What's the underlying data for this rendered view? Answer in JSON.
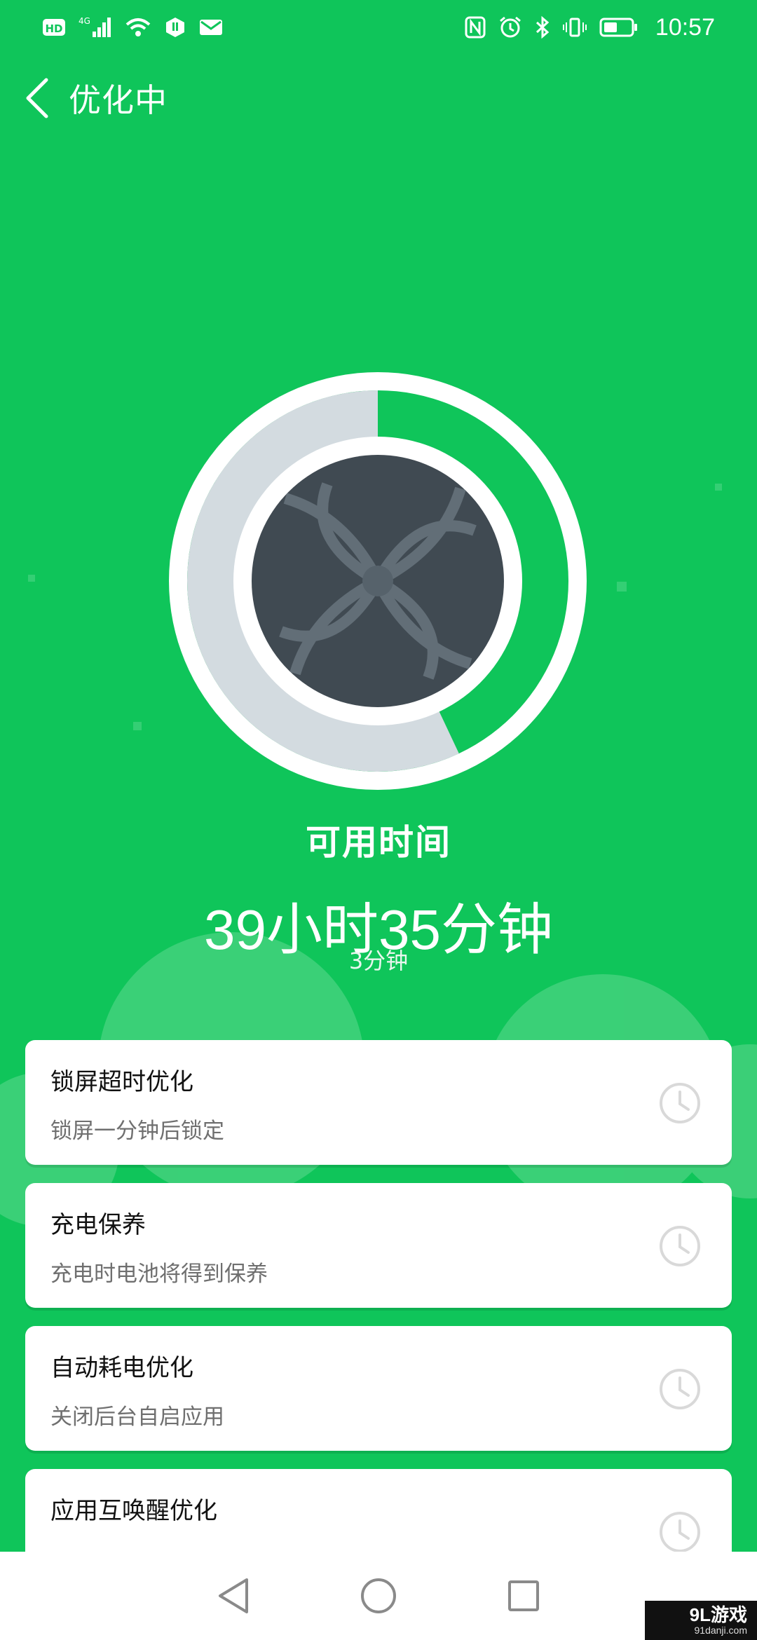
{
  "status_bar": {
    "hd_label": "HD",
    "network_label": "4G",
    "time": "10:57"
  },
  "header": {
    "title": "优化中"
  },
  "gauge": {
    "remaining_fraction": 0.57,
    "colors": {
      "ring": "#ffffff",
      "progress": "#d3dbe0",
      "track": "#0fc55a",
      "center": "#404a52"
    }
  },
  "summary": {
    "label": "可用时间",
    "value": "39小时35分钟",
    "sub_value": "3分钟"
  },
  "cards": [
    {
      "title": "锁屏超时优化",
      "desc": "锁屏一分钟后锁定",
      "icon": "clock-icon"
    },
    {
      "title": "充电保养",
      "desc": "充电时电池将得到保养",
      "icon": "clock-icon"
    },
    {
      "title": "自动耗电优化",
      "desc": "关闭后台自启应用",
      "icon": "clock-icon"
    },
    {
      "title": "应用互唤醒优化",
      "desc": "",
      "icon": "clock-icon"
    }
  ],
  "watermark": {
    "brand": "9L游戏",
    "site": "91danji.com"
  },
  "colors": {
    "background": "#0fc55a",
    "card": "#ffffff",
    "accent": "#0fc55a"
  }
}
